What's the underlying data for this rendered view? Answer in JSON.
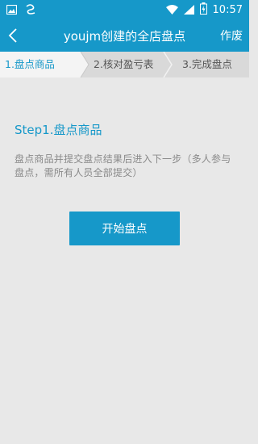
{
  "status_bar": {
    "time": "10:57"
  },
  "title_bar": {
    "title": "youjm创建的全店盘点",
    "action_label": "作废"
  },
  "steps": [
    {
      "label": "1.盘点商品",
      "active": true
    },
    {
      "label": "2.核对盈亏表",
      "active": false
    },
    {
      "label": "3.完成盘点",
      "active": false
    }
  ],
  "main": {
    "heading": "Step1.盘点商品",
    "description": "盘点商品并提交盘点结果后进入下一步（多人参与盘点，需所有人员全部提交）",
    "start_button_label": "开始盘点"
  },
  "colors": {
    "accent": "#1698c9",
    "background": "#e8e8e8",
    "step_active_bg": "#f4f4f4",
    "step_inactive_bg": "#d9d9d9"
  }
}
